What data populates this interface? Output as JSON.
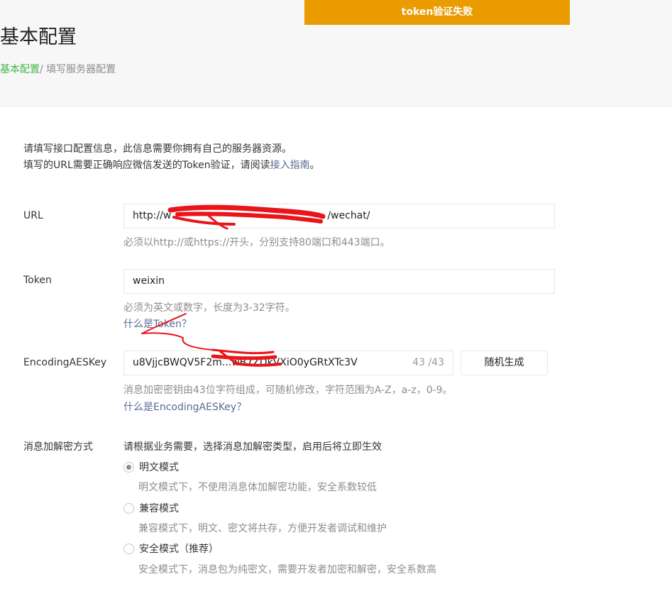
{
  "toast": {
    "message": "token验证失败"
  },
  "page": {
    "title": "基本配置"
  },
  "breadcrumb": {
    "root": "基本配置",
    "separator": "/",
    "current": "填写服务器配置"
  },
  "intro": {
    "line1": "请填写接口配置信息，此信息需要你拥有自己的服务器资源。",
    "line2_prefix": "填写的URL需要正确响应微信发送的Token验证，请阅读",
    "line2_link": "接入指南",
    "line2_suffix": "。"
  },
  "url": {
    "label": "URL",
    "value_start": "http://w",
    "value_end": "/wechat/",
    "hint": "必须以http://或https://开头，分别支持80端口和443端口。"
  },
  "token": {
    "label": "Token",
    "value": "weixin",
    "hint": "必须为英文或数字，长度为3-32字符。",
    "help_link": "什么是Token？"
  },
  "aes": {
    "label": "EncodingAESKey",
    "value": "u8VjjcBWQV5F2m...wB7ZDkVXiO0yGRtXTc3V",
    "counter": "43 /43",
    "generate_button": "随机生成",
    "hint": "消息加密密钥由43位字符组成，可随机修改，字符范围为A-Z，a-z，0-9。",
    "help_link": "什么是EncodingAESKey？"
  },
  "encryption": {
    "label": "消息加解密方式",
    "instruction": "请根据业务需要，选择消息加解密类型，启用后将立即生效",
    "options": [
      {
        "label": "明文模式",
        "desc": "明文模式下，不使用消息体加解密功能，安全系数较低",
        "checked": true
      },
      {
        "label": "兼容模式",
        "desc": "兼容模式下，明文、密文将共存，方便开发者调试和维护",
        "checked": false
      },
      {
        "label": "安全模式（推荐）",
        "desc": "安全模式下，消息包为纯密文，需要开发者加密和解密，安全系数高",
        "checked": false
      }
    ]
  },
  "colors": {
    "toast_bg": "#e99b00",
    "breadcrumb_link": "#44b549",
    "help_link": "#576b95",
    "redaction": "#e8161b"
  }
}
